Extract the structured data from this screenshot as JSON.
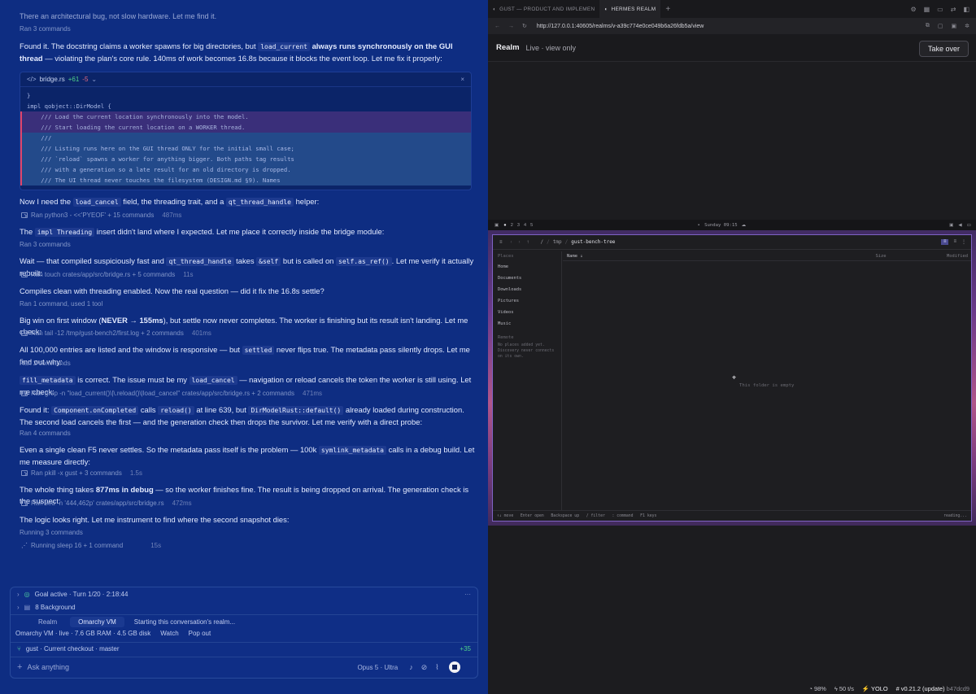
{
  "chat": {
    "top_partial": "There an architectural bug, not slow hardware. Let me find it.",
    "ran3_top": "Ran 3 commands",
    "p1": {
      "a": "Found it. The docstring claims a worker spawns for big directories, but ",
      "code": "load_current",
      "b": " always runs synchronously on the GUI thread",
      "c": " — violating the plan's core rule. 140ms of work becomes 16.8s because it blocks the event loop. Let me fix it properly:"
    },
    "codebox": {
      "filename": "bridge.rs",
      "added": "+61",
      "removed": "-5",
      "lines": [
        "}",
        "impl qobject::DirModel {",
        "    /// Load the current location synchronously into the model.",
        "    /// Start loading the current location on a WORKER thread.",
        "    ///",
        "    /// Listing runs here on the GUI thread ONLY for the initial small case;",
        "    /// `reload` spawns a worker for anything bigger. Both paths tag results",
        "    /// with a generation so a late result for an old directory is dropped.",
        "    /// The UI thread never touches the filesystem (DESIGN.md §9). Names"
      ]
    },
    "p2": {
      "a": "Now I need the ",
      "code1": "load_cancel",
      "b": " field, the threading trait, and a ",
      "code2": "qt_thread_handle",
      "c": " helper:"
    },
    "r2": {
      "cmd": "Ran python3 - <<'PYEOF' + 15 commands",
      "dur": "487ms"
    },
    "p3": {
      "a": "The ",
      "code": "impl Threading",
      "b": " insert didn't land where I expected. Let me place it correctly inside the bridge module:"
    },
    "m3": "Ran 3 commands",
    "p4": {
      "a": "Wait — that compiled suspiciously fast and ",
      "code1": "qt_thread_handle",
      "b": " takes ",
      "code2": "&self",
      "c": " but is called on ",
      "code3": "self.as_ref()",
      "d": ". Let me verify it actually rebuilt:"
    },
    "r4": {
      "cmd": "Ran touch crates/app/src/bridge.rs + 5 commands",
      "dur": "11s"
    },
    "p5": "Compiles clean with threading enabled. Now the real question — did it fix the 16.8s settle?",
    "m5": "Ran 1 command, used 1 tool",
    "p6": {
      "a": "Big win on first window (",
      "b": "NEVER → 155ms",
      "c": "), but settle now never completes. The worker is finishing but its result isn't landing. Let me check:"
    },
    "r6": {
      "cmd": "Ran tail -12 /tmp/gust-bench2/first.log + 2 commands",
      "dur": "401ms"
    },
    "p7": {
      "a": "All 100,000 entries are listed and the window is responsive — but ",
      "code": "settled",
      "b": " never flips true. The metadata pass silently drops. Let me find out why:"
    },
    "m7": "Ran 2 commands",
    "p8": {
      "code1": "fill_metadata",
      "a": " is correct. The issue must be my ",
      "code2": "load_cancel",
      "b": " — navigation or reload cancels the token the worker is still using. Let me check:"
    },
    "r8": {
      "cmd": "Ran grep -n \"load_current()\\|\\.reload()\\|load_cancel\" crates/app/src/bridge.rs + 2 commands",
      "dur": "471ms"
    },
    "p9": {
      "a": "Found it: ",
      "code1": "Component.onCompleted",
      "b": " calls ",
      "code2": "reload()",
      "c": " at line 639, but ",
      "code3": "DirModelRust::default()",
      "d": " already loaded during construction. The second load cancels the first — and the generation check then drops the survivor. Let me verify with a direct probe:"
    },
    "m9": "Ran 4 commands",
    "p10": {
      "a": "Even a single clean F5 never settles. So the metadata pass itself is the problem — 100k ",
      "code": "symlink_metadata",
      "b": " calls in a debug build. Let me measure directly:"
    },
    "r10": {
      "cmd": "Ran pkill -x gust + 3 commands",
      "dur": "1.5s"
    },
    "p11": {
      "a": "The whole thing takes ",
      "b": "877ms in debug",
      "c": " — so the worker finishes fine. The result is being dropped on arrival. The generation check is the suspect:"
    },
    "r11": {
      "cmd": "Ran sed -n '444,462p' crates/app/src/bridge.rs",
      "dur": "472ms"
    },
    "p12": "The logic looks right. Let me instrument to find where the second snapshot dies:",
    "m12": "Running 3 commands",
    "r12": {
      "cmd": "Running sleep 16 + 1 command",
      "dur": "15s"
    }
  },
  "composer": {
    "goal": "Goal active · Turn 1/20 · 2:18:44",
    "background": "8 Background",
    "tab_realm": "Realm",
    "tab_vm": "Omarchy VM",
    "status_msg": "Starting this conversation's realm...",
    "vm_info": "Omarchy VM · live · 7.6 GB RAM · 4.5 GB disk",
    "watch": "Watch",
    "popout": "Pop out",
    "branch": "gust · Current checkout · master",
    "diff": "+35",
    "placeholder": "Ask anything",
    "model": "Opus 5 · Ultra",
    "more": "···"
  },
  "browser": {
    "tab1": "GUST — PRODUCT AND IMPLEMEN",
    "tab2": "HERMES REALM",
    "url": "http://127.0.0.1:40605/realms/v-a39c774e0ce049b6a26fdb5a/view",
    "realm_title": "Realm",
    "realm_mode": "Live · view only",
    "take_over": "Take over"
  },
  "vm": {
    "workspaces": [
      "2",
      "3",
      "4",
      "5"
    ],
    "clock": "Sunday 09:15",
    "path": [
      "/",
      "tmp",
      "gust-bench-tree"
    ],
    "places_title": "Places",
    "places": [
      "Home",
      "Documents",
      "Downloads",
      "Pictures",
      "Videos",
      "Music"
    ],
    "remote_title": "Remote",
    "remote_msg": "No places added yet. Discovery never connects on its own.",
    "col_name": "Name ↓",
    "col_size": "Size",
    "col_modified": "Modified",
    "empty": "This folder is empty",
    "hint": "↑↓ move   Enter open   Backspace up   / filter   : command   F1 keys",
    "reading": "reading..."
  },
  "status": {
    "ctx": "98%",
    "rate": "50 t/s",
    "mode": "YOLO",
    "version": "v0.21.2 (update)",
    "commit": "b47dcd9"
  },
  "colors": {
    "left_bg": "#0e2d82",
    "right_bg": "#1c1c1f",
    "accent_border": "#7e63c4"
  }
}
